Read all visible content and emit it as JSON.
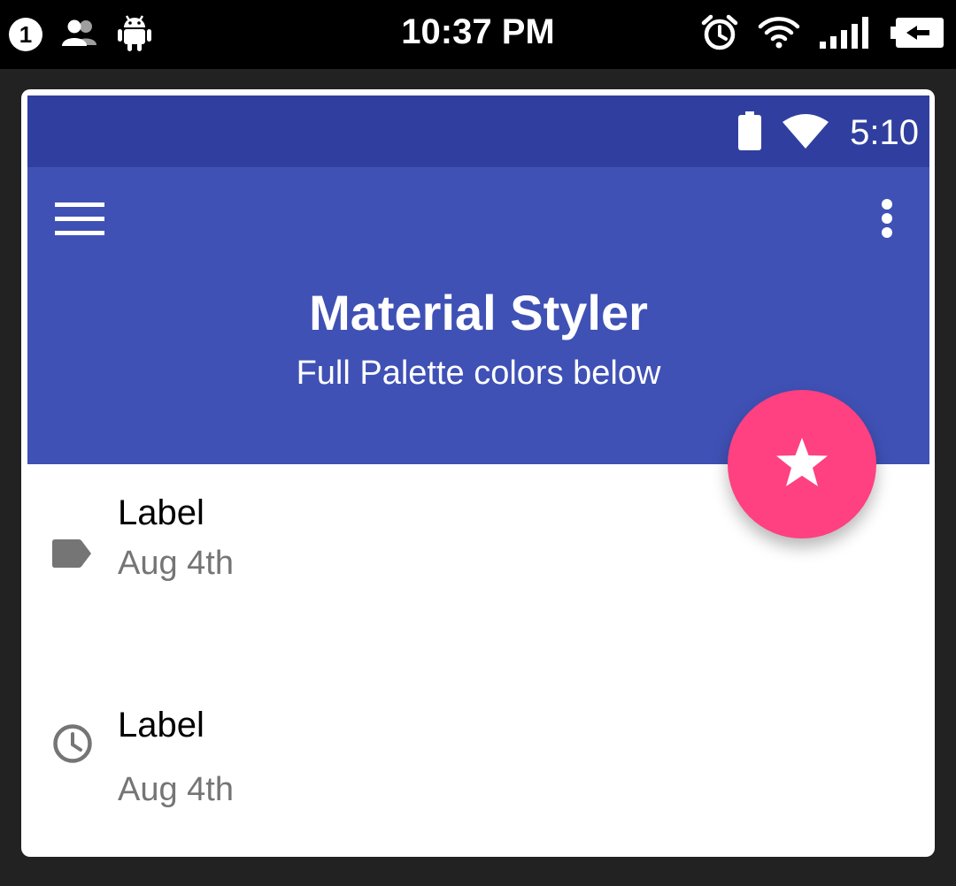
{
  "system_bar": {
    "notification_count": "1",
    "time": "10:37 PM",
    "icons": [
      "notification-count-icon",
      "users-icon",
      "android-icon",
      "alarm-icon",
      "wifi-icon",
      "signal-icon",
      "battery-charging-icon"
    ]
  },
  "app_status": {
    "time": "5:10",
    "icons": [
      "battery-icon",
      "wifi-icon"
    ]
  },
  "toolbar": {
    "title": "Material Styler",
    "subtitle": "Full Palette colors below",
    "menu_icon": "menu-icon",
    "overflow_icon": "more-vert-icon"
  },
  "fab": {
    "icon": "star-icon"
  },
  "list": [
    {
      "icon": "label-icon",
      "primary": "Label",
      "secondary": "Aug 4th"
    },
    {
      "icon": "clock-icon",
      "primary": "Label",
      "secondary": "Aug 4th"
    }
  ],
  "colors": {
    "primary_dark": "#303F9F",
    "primary": "#3F51B5",
    "accent": "#FF4081",
    "icon_grey": "#757575",
    "background": "#222222"
  }
}
